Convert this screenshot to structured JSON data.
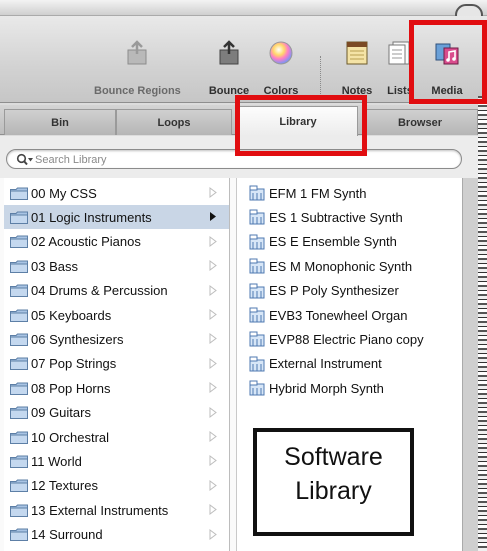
{
  "toolbar": {
    "items": [
      {
        "label": "Bounce Regions",
        "icon": "bounce-regions-icon"
      },
      {
        "label": "Bounce",
        "icon": "bounce-icon"
      },
      {
        "label": "Colors",
        "icon": "colors-icon"
      },
      {
        "label": "Notes",
        "icon": "notes-icon"
      },
      {
        "label": "Lists",
        "icon": "lists-icon"
      },
      {
        "label": "Media",
        "icon": "media-icon"
      }
    ]
  },
  "tabs": [
    "Bin",
    "Loops",
    "Library",
    "Browser"
  ],
  "active_tab": "Library",
  "search": {
    "placeholder": "Search Library"
  },
  "categories": [
    "00 My CSS",
    "01 Logic Instruments",
    "02 Acoustic Pianos",
    "03 Bass",
    "04 Drums & Percussion",
    "05 Keyboards",
    "06 Synthesizers",
    "07 Pop Strings",
    "08 Pop Horns",
    "09 Guitars",
    "10 Orchestral",
    "11 World",
    "12 Textures",
    "13 External Instruments",
    "14 Surround"
  ],
  "selected_category": "01 Logic Instruments",
  "instruments": [
    "EFM 1 FM Synth",
    "ES 1 Subtractive Synth",
    "ES E Ensemble Synth",
    "ES M Monophonic Synth",
    "ES P Poly Synthesizer",
    "EVB3 Tonewheel Organ",
    "EVP88 Electric Piano copy",
    "External Instrument",
    "Hybrid Morph Synth"
  ],
  "callout": {
    "line1": "Software",
    "line2": "Library"
  },
  "colors": {
    "highlight": "#e10d10",
    "selected_row": "#c9d6e6"
  }
}
